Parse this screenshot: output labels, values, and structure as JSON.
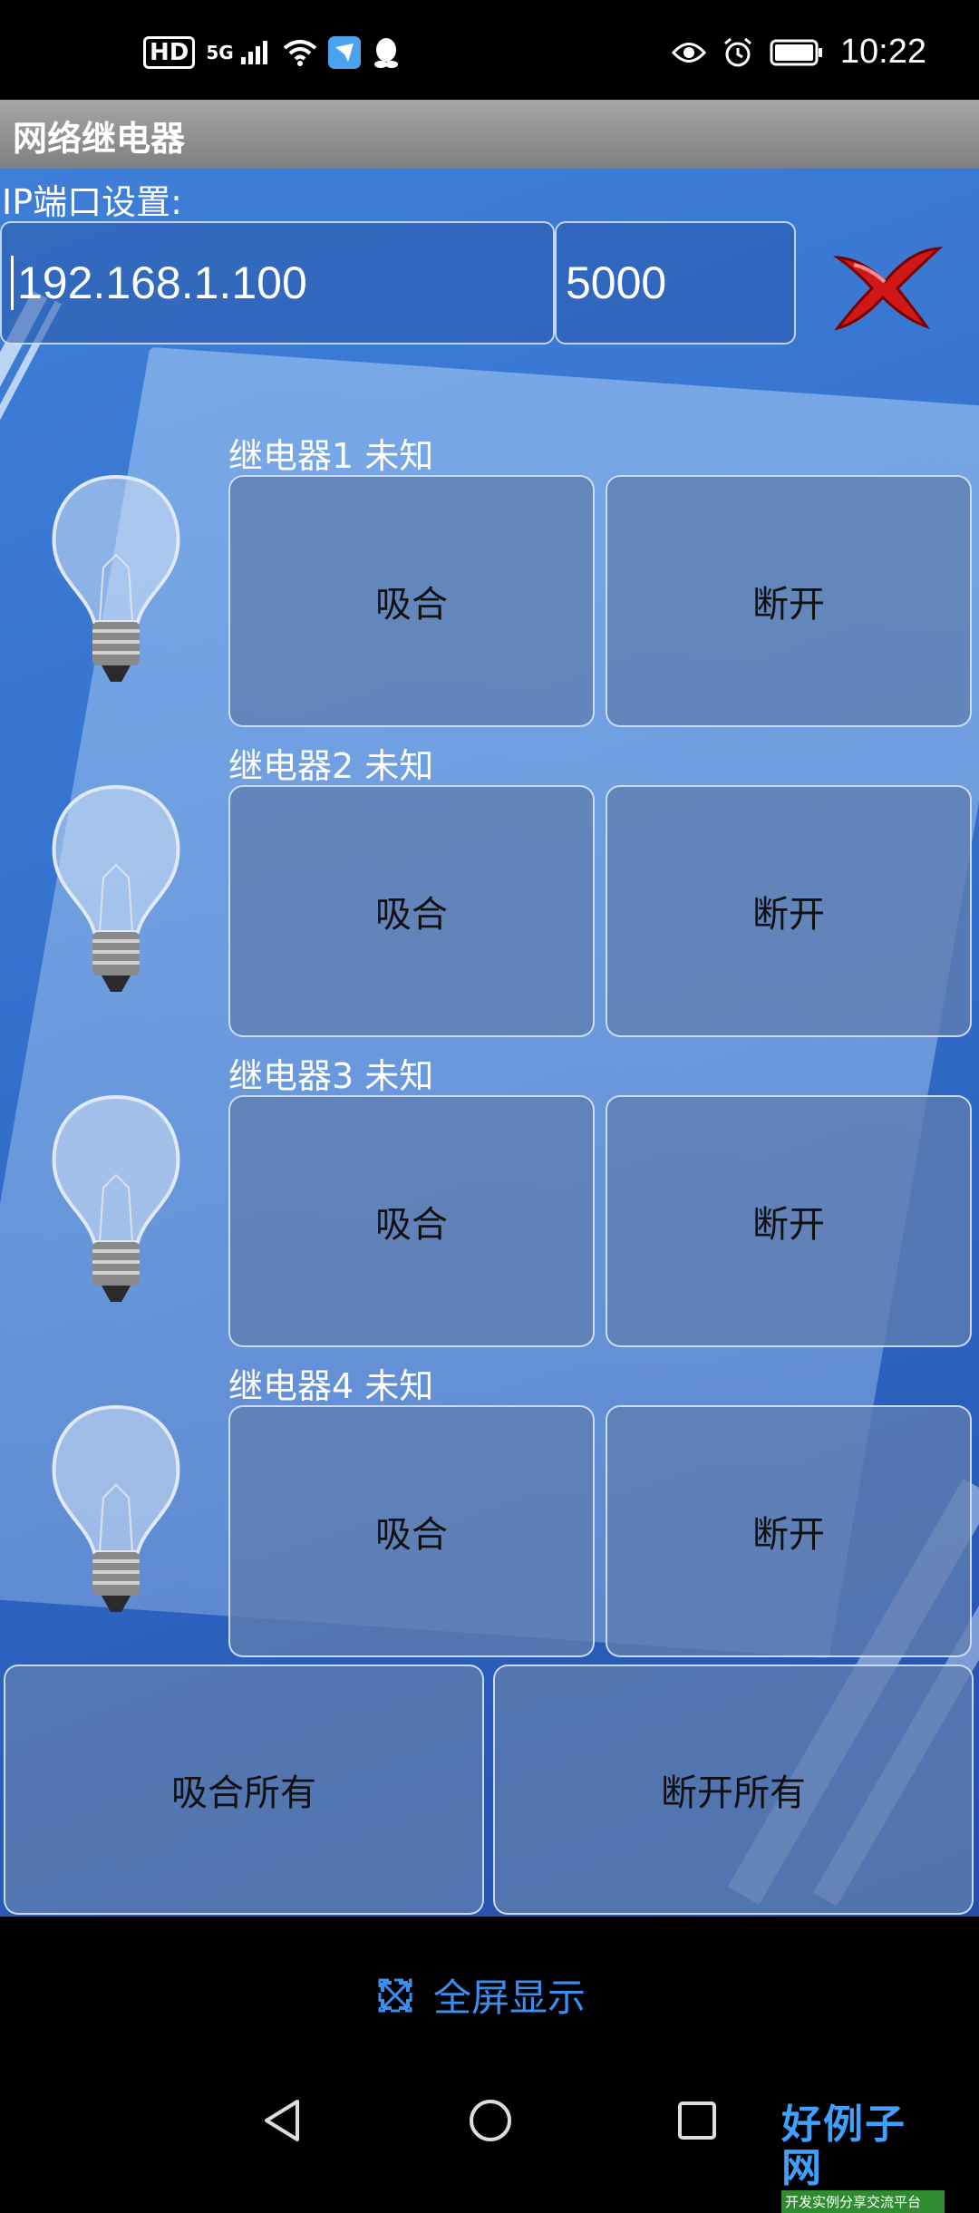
{
  "status_bar": {
    "hd_badge": "HD",
    "network": "5G",
    "time": "10:22",
    "left_icons": [
      "signal-icon",
      "wifi-icon",
      "app-notification-icon",
      "qq-icon"
    ],
    "right_icons": [
      "eye-icon",
      "alarm-icon",
      "battery-icon"
    ]
  },
  "app": {
    "title": "网络继电器",
    "ip_label": "IP端口设置:",
    "ip_value": "192.168.1.100",
    "port_value": "5000",
    "relays": [
      {
        "label": "继电器1 未知",
        "on": "吸合",
        "off": "断开"
      },
      {
        "label": "继电器2 未知",
        "on": "吸合",
        "off": "断开"
      },
      {
        "label": "继电器3 未知",
        "on": "吸合",
        "off": "断开"
      },
      {
        "label": "继电器4 未知",
        "on": "吸合",
        "off": "断开"
      }
    ],
    "all_on": "吸合所有",
    "all_off": "断开所有"
  },
  "bottom": {
    "fullscreen_label": "全屏显示"
  },
  "watermark": {
    "logo_main": "好例子网",
    "logo_sub": "开发实例分享交流平台"
  },
  "colors": {
    "accent": "#3b8ff0",
    "background_blue": "#3673cf",
    "close_red": "#d01818"
  }
}
